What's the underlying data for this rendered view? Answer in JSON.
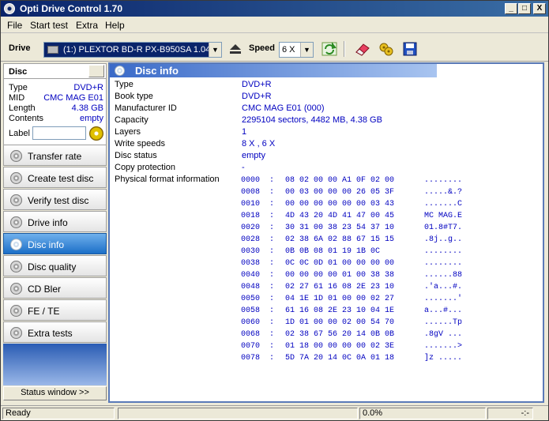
{
  "window": {
    "title": "Opti Drive Control 1.70",
    "min": "_",
    "max": "□",
    "close": "X"
  },
  "menu": [
    "File",
    "Start test",
    "Extra",
    "Help"
  ],
  "toolbar": {
    "drive_label": "Drive",
    "drive_value": "(1:)   PLEXTOR BD-R  PX-B950SA 1.04",
    "speed_label": "Speed",
    "speed_value": "6 X"
  },
  "left": {
    "disc_header": "Disc",
    "props": [
      {
        "k": "Type",
        "v": "DVD+R"
      },
      {
        "k": "MID",
        "v": "CMC MAG E01"
      },
      {
        "k": "Length",
        "v": "4.38 GB"
      },
      {
        "k": "Contents",
        "v": "empty"
      }
    ],
    "label_key": "Label",
    "nav": [
      {
        "label": "Transfer rate",
        "active": false
      },
      {
        "label": "Create test disc",
        "active": false
      },
      {
        "label": "Verify test disc",
        "active": false
      },
      {
        "label": "Drive info",
        "active": false
      },
      {
        "label": "Disc info",
        "active": true
      },
      {
        "label": "Disc quality",
        "active": false
      },
      {
        "label": "CD Bler",
        "active": false
      },
      {
        "label": "FE / TE",
        "active": false
      },
      {
        "label": "Extra tests",
        "active": false
      }
    ],
    "status_window": "Status window >>"
  },
  "main": {
    "header": "Disc info",
    "info": [
      {
        "k": "Type",
        "v": "DVD+R"
      },
      {
        "k": "Book type",
        "v": "DVD+R"
      },
      {
        "k": "Manufacturer ID",
        "v": "CMC MAG E01 (000)"
      },
      {
        "k": "Capacity",
        "v": "2295104 sectors, 4482 MB, 4.38 GB"
      },
      {
        "k": "Layers",
        "v": "1"
      },
      {
        "k": "Write speeds",
        "v": "8 X , 6 X"
      },
      {
        "k": "Disc status",
        "v": "empty"
      },
      {
        "k": "Copy protection",
        "v": "-"
      },
      {
        "k": "Physical format information",
        "v": ""
      }
    ],
    "hex": [
      {
        "addr": "0000",
        "bytes": "08 02 00 00 A1 0F 02 00",
        "ascii": "........"
      },
      {
        "addr": "0008",
        "bytes": "00 03 00 00 00 26 05 3F",
        "ascii": ".....&.?"
      },
      {
        "addr": "0010",
        "bytes": "00 00 00 00 00 00 03 43",
        "ascii": ".......C"
      },
      {
        "addr": "0018",
        "bytes": "4D 43 20 4D 41 47 00 45",
        "ascii": "MC MAG.E"
      },
      {
        "addr": "0020",
        "bytes": "30 31 00 38 23 54 37 10",
        "ascii": "01.8#T7."
      },
      {
        "addr": "0028",
        "bytes": "02 38 6A 02 88 67 15 15",
        "ascii": ".8j..g.."
      },
      {
        "addr": "0030",
        "bytes": "0B 0B 08 01 19 1B 0C",
        "ascii": "........"
      },
      {
        "addr": "0038",
        "bytes": "0C 0C 0D 01 00 00 00 00",
        "ascii": "........"
      },
      {
        "addr": "0040",
        "bytes": "00 00 00 00 01 00 38 38",
        "ascii": "......88"
      },
      {
        "addr": "0048",
        "bytes": "02 27 61 16 08 2E 23 10",
        "ascii": ".'a...#."
      },
      {
        "addr": "0050",
        "bytes": "04 1E 1D 01 00 00 02 27",
        "ascii": ".......'"
      },
      {
        "addr": "0058",
        "bytes": "61 16 08 2E 23 10 04 1E",
        "ascii": "a...#..."
      },
      {
        "addr": "0060",
        "bytes": "1D 01 00 00 02 00 54 70",
        "ascii": "......Tp"
      },
      {
        "addr": "0068",
        "bytes": "02 38 67 56 20 14 0B 0B",
        "ascii": ".8gV ..."
      },
      {
        "addr": "0070",
        "bytes": "01 18 00 00 00 00 02 3E",
        "ascii": ".......>"
      },
      {
        "addr": "0078",
        "bytes": "5D 7A 20 14 0C 0A 01 18",
        "ascii": "]z ....."
      }
    ]
  },
  "status": {
    "text": "Ready",
    "progress": "0.0%",
    "time": "-:-"
  }
}
